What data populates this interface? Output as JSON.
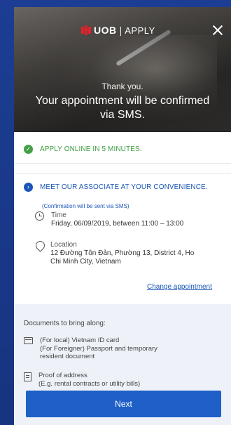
{
  "header": {
    "brand": "UOB",
    "separator": "|",
    "subtitle": "APPLY",
    "thank_you": "Thank you.",
    "headline": "Your appointment will be confirmed via SMS."
  },
  "steps": {
    "apply_online": "APPLY ONLINE IN 5 MINUTES.",
    "meet_associate": "MEET OUR ASSOCIATE AT YOUR CONVENIENCE."
  },
  "appointment": {
    "note": "(Confirmation will be sent via SMS)",
    "time_label": "Time",
    "time_value": "Friday, 06/09/2019, between 11:00 – 13:00",
    "location_label": "Location",
    "location_line1": "12 Đường Tôn Đản, Phường 13, District 4, Ho",
    "location_line2": "Chi Minh City, Vietnam",
    "change_link": "Change appointment"
  },
  "documents": {
    "title": "Documents to bring along:",
    "id_line1": "(For local) Vietnam ID card",
    "id_line2": "(For Foreigner) Passport and temporary",
    "id_line3": "resident document",
    "address_line1": "Proof of address",
    "address_line2": "(E.g. rental contracts or utility bills)"
  },
  "actions": {
    "next_label": "Next"
  },
  "colors": {
    "background": "#1a3a8c",
    "brand_red": "#e0202a",
    "success_green": "#43a047",
    "primary_blue": "#1e5fc8"
  },
  "icons": {
    "close": "close-icon",
    "check": "check-icon",
    "chevron": "chevron-right-icon",
    "clock": "clock-icon",
    "pin": "location-pin-icon",
    "id": "id-card-icon",
    "doc": "document-icon"
  }
}
